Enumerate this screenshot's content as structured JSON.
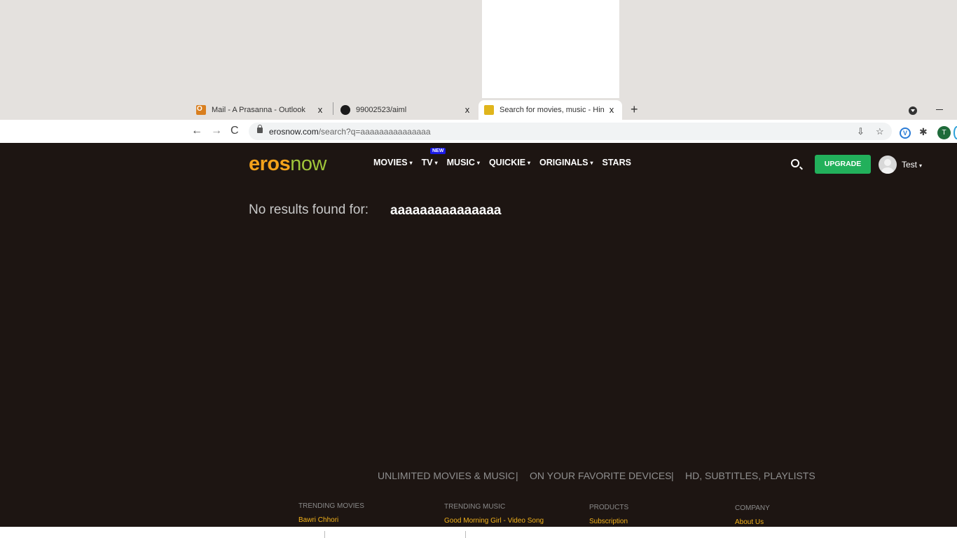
{
  "browser": {
    "tabs": [
      {
        "title": "Mail - A Prasanna - Outlook",
        "favicon": "outlook-icon",
        "close": "x"
      },
      {
        "title": "99002523/aiml",
        "favicon": "github-icon",
        "close": "x"
      },
      {
        "title": "Search for movies, music - Hindi",
        "favicon": "erosnow-icon",
        "close": "x",
        "active": true
      }
    ],
    "new_tab": "+",
    "back": "←",
    "forward": "→",
    "reload": "C",
    "url_host": "erosnow.com",
    "url_path": "/search?q=aaaaaaaaaaaaaaa",
    "profile_initial": "T",
    "extension_v": "V"
  },
  "site": {
    "logo_eros": "eros",
    "logo_now": "now",
    "menu": [
      {
        "label": "MOVIES",
        "caret": "▾"
      },
      {
        "label": "TV",
        "caret": "▾"
      },
      {
        "label": "MUSIC",
        "caret": "▾"
      },
      {
        "label": "QUICKIE",
        "caret": "▾"
      },
      {
        "label": "ORIGINALS",
        "caret": "▾"
      },
      {
        "label": "STARS",
        "caret": ""
      }
    ],
    "new_badge": "NEW",
    "upgrade_label": "UPGRADE",
    "user_name": "Test",
    "user_caret": "▾"
  },
  "search": {
    "no_results_label": "No results found for:",
    "query": "aaaaaaaaaaaaaaa"
  },
  "footer": {
    "taglines": [
      "UNLIMITED MOVIES & MUSIC",
      "ON YOUR FAVORITE DEVICES",
      "HD, SUBTITLES, PLAYLISTS"
    ],
    "separator": "|",
    "columns": [
      {
        "heading": "TRENDING MOVIES",
        "link": "Bawri Chhori"
      },
      {
        "heading": "TRENDING MUSIC",
        "link": "Good Morning Girl - Video Song"
      },
      {
        "heading": "PRODUCTS",
        "link": "Subscription"
      },
      {
        "heading": "COMPANY",
        "link": "About Us"
      }
    ]
  },
  "colors": {
    "page_bg": "#1d1512",
    "logo_eros": "#f3a21b",
    "logo_now": "#9fc43a",
    "upgrade_bg": "#22b05b",
    "footer_link": "#f3b21b",
    "new_badge": "#1a1ae6"
  }
}
